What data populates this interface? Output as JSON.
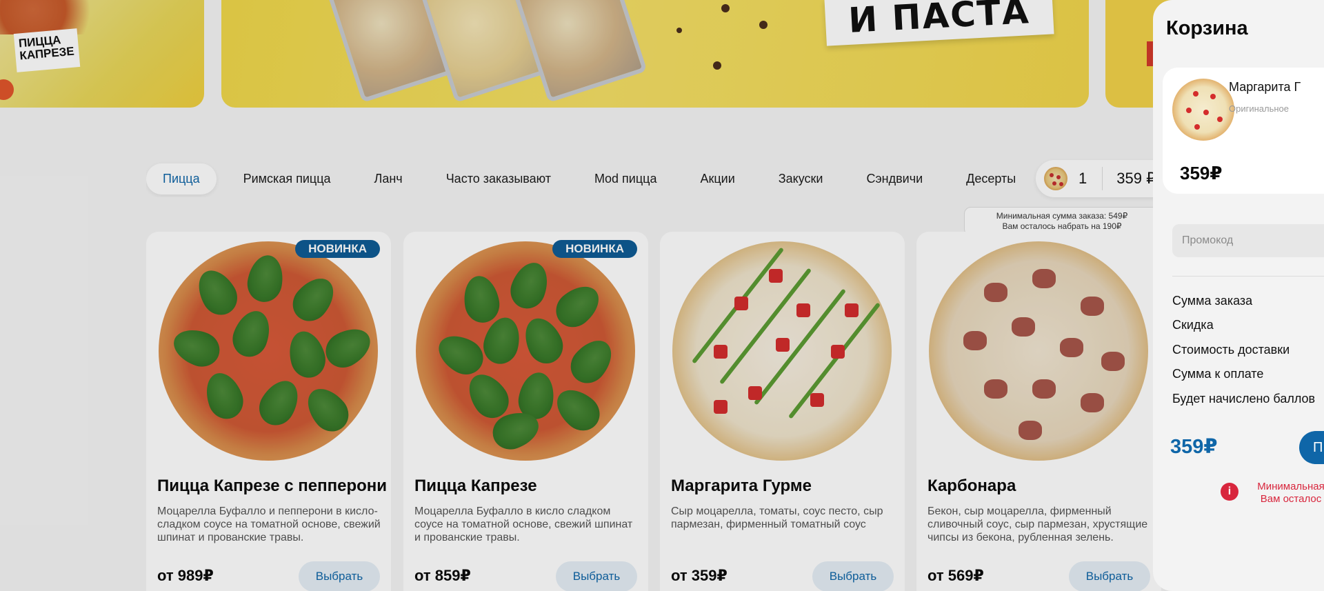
{
  "banner": {
    "left_tag": "ПИЦЦА КАПРЕЗЕ",
    "headline": "И ПАСТА"
  },
  "categories": [
    {
      "label": "Пицца",
      "active": true
    },
    {
      "label": "Римская пицца",
      "active": false
    },
    {
      "label": "Ланч",
      "active": false
    },
    {
      "label": "Часто заказывают",
      "active": false
    },
    {
      "label": "Mod пицца",
      "active": false
    },
    {
      "label": "Акции",
      "active": false
    },
    {
      "label": "Закуски",
      "active": false
    },
    {
      "label": "Сэндвичи",
      "active": false
    },
    {
      "label": "Десерты",
      "active": false
    }
  ],
  "mini_cart": {
    "count": "1",
    "price": "359 ₽"
  },
  "min_order_note": {
    "line1": "Минимальная сумма заказа: 549₽",
    "line2": "Вам осталось набрать на 190₽"
  },
  "products": [
    {
      "badge": "НОВИНКА",
      "title": "Пицца Капрезе с пепперони",
      "description": "Моцарелла Буфалло и пепперони в кисло- сладком соусе на томатной основе, свежий шпинат и прованские травы.",
      "price": "от 989₽",
      "button": "Выбрать"
    },
    {
      "badge": "НОВИНКА",
      "title": "Пицца Капрезе",
      "description": "Моцарелла Буфалло в кисло сладком соусе на томатной основе, свежий шпинат и прованские травы.",
      "price": "от 859₽",
      "button": "Выбрать"
    },
    {
      "badge": "",
      "title": "Маргарита Гурме",
      "description": "Сыр моцарелла, томаты, соус песто, сыр пармезан, фирменный томатный соус",
      "price": "от 359₽",
      "button": "Выбрать"
    },
    {
      "badge": "",
      "title": "Карбонара",
      "description": "Бекон, сыр моцарелла, фирменный сливочный соус, сыр пармезан, хрустящие чипсы из бекона, рубленная зелень.",
      "price": "от 569₽",
      "button": "Выбрать"
    }
  ],
  "cart": {
    "title": "Корзина",
    "item": {
      "name": "Маргарита Г",
      "variant": "Оригинальное",
      "price": "359₽"
    },
    "promo_placeholder": "Промокод",
    "summary": [
      "Сумма заказа",
      "Скидка",
      "Стоимость доставки",
      "Сумма к оплате",
      "Будет начислено баллов"
    ],
    "total": "359₽",
    "checkout_label": "П",
    "warning_line1": "Минимальная",
    "warning_line2": "Вам осталос"
  },
  "colors": {
    "accent": "#0f66a8",
    "badge": "#0f5c95",
    "warning": "#d8263d",
    "banner_yellow": "#f0d84a"
  }
}
